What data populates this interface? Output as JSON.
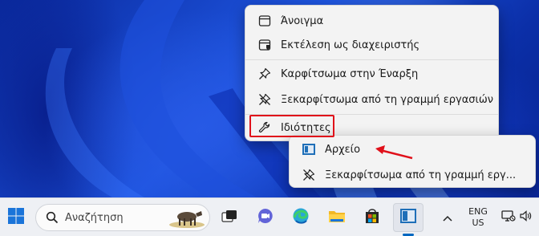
{
  "context_menu": {
    "items": [
      {
        "label": "Άνοιγμα",
        "icon": "window-icon"
      },
      {
        "label": "Εκτέλεση ως διαχειριστής",
        "icon": "shield-window-icon"
      },
      {
        "label": "Καρφίτσωμα στην Έναρξη",
        "icon": "pin-icon"
      },
      {
        "label": "Ξεκαρφίτσωμα από τη γραμμή εργασιών",
        "icon": "unpin-icon"
      },
      {
        "label": "Ιδιότητες",
        "icon": "wrench-icon"
      }
    ]
  },
  "jump_list": {
    "items": [
      {
        "label": "Αρχείο",
        "icon": "app-icon"
      },
      {
        "label": "Ξεκαρφίτσωμα από τη γραμμή εργ...",
        "icon": "unpin-icon"
      }
    ]
  },
  "taskbar": {
    "search_placeholder": "Αναζήτηση",
    "language_line1": "ENG",
    "language_line2": "US"
  },
  "colors": {
    "annotation_red": "#e0101a",
    "accent_blue": "#0067c0"
  }
}
